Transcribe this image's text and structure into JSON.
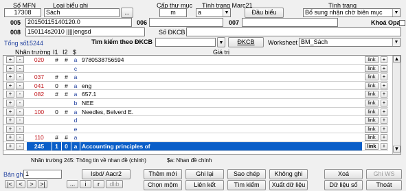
{
  "header": {
    "mfn_label": "Số MFN",
    "mfn_value": "17308",
    "record_type_label": "Loại biểu ghi",
    "record_type_value": "Sách",
    "browse_label": "...",
    "level_label": "Cấp thư mục",
    "level_value": "m",
    "marc_status_label": "Tình trạng Marc21",
    "marc_status_value": "a",
    "status_label": "Tình trạng",
    "status_value": "Bổ sung nhận chờ biên mục",
    "leader_button": "Đầu biểu",
    "f005_label": "005",
    "f005_value": "20150115140120.0",
    "f006_label": "006",
    "f006_value": "",
    "f007_label": "007",
    "f007_value": "",
    "opac_lock_label": "Khoá Opac",
    "f008_label": "008",
    "f008_value": "150114s2010        |||||engsd",
    "dkcb_label": "Số ĐKCB",
    "dkcb_value": ""
  },
  "searchbar": {
    "total_label": "Tổng số:",
    "total_value": "15244",
    "search_label": "Tìm kiếm theo ĐKCB",
    "search_value": "",
    "dkcb_button": "ĐKCB",
    "worksheet_label": "Worksheet",
    "worksheet_value": "BM_Sách"
  },
  "grid": {
    "headers": {
      "tag": "Nhãn trường",
      "i1": "I1",
      "i2": "I2",
      "sub": "$",
      "value": "Giá trị"
    },
    "link_label": "link",
    "rows": [
      {
        "tag": "020",
        "i1": "#",
        "i2": "#",
        "sub": "a",
        "value": "9780538756594"
      },
      {
        "tag": "",
        "i1": "",
        "i2": "",
        "sub": "c",
        "value": ""
      },
      {
        "tag": "037",
        "i1": "#",
        "i2": "#",
        "sub": "a",
        "value": ""
      },
      {
        "tag": "041",
        "i1": "0",
        "i2": "#",
        "sub": "a",
        "value": "eng"
      },
      {
        "tag": "082",
        "i1": "#",
        "i2": "#",
        "sub": "a",
        "value": "657.1"
      },
      {
        "tag": "",
        "i1": "",
        "i2": "",
        "sub": "b",
        "value": "NEE"
      },
      {
        "tag": "100",
        "i1": "0",
        "i2": "#",
        "sub": "a",
        "value": "Needles, Belverd E."
      },
      {
        "tag": "",
        "i1": "",
        "i2": "",
        "sub": "d",
        "value": ""
      },
      {
        "tag": "",
        "i1": "",
        "i2": "",
        "sub": "e",
        "value": ""
      },
      {
        "tag": "110",
        "i1": "#",
        "i2": "#",
        "sub": "a",
        "value": ""
      },
      {
        "tag": "245",
        "i1": "1",
        "i2": "0",
        "sub": "a",
        "value": "Accounting principles of"
      }
    ]
  },
  "statusline": {
    "field_info": "Nhãn trường 245: Thông tin về nhan đề (chính)",
    "sub_info": "$a: Nhan đề chính"
  },
  "footer": {
    "record_label": "Bản ghi",
    "record_value": "1",
    "isbd_button": "Isbd/ Aacr2",
    "add_button": "Thêm mới",
    "save_button": "Ghi lại",
    "copy_button": "Sao chép",
    "nosave_button": "Không ghi",
    "delete_button": "Xoá",
    "ghiws_button": "Ghi WS",
    "choose_button": "Chọn mộm",
    "link_button": "Liên kết",
    "search_button": "Tìm kiếm",
    "export_button": "Xuất dữ liệu",
    "datasource_button": "Dữ liệu số",
    "exit_button": "Thoát",
    "nav_first": "|<",
    "nav_prev": "<",
    "nav_next": ">",
    "nav_last": ">|",
    "nav_browse": "...",
    "nav_i": "i",
    "nav_r": "r",
    "nav_dlib": "dlib"
  }
}
